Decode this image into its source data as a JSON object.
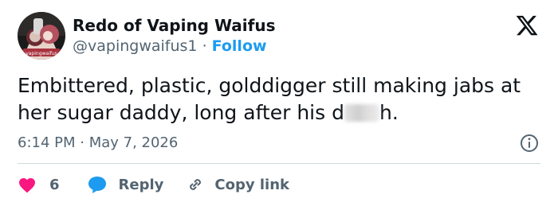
{
  "account": {
    "display_name": "Redo of Vaping Waifus",
    "handle": "@vapingwaifus1",
    "separator": "·",
    "follow_label": "Follow"
  },
  "tweet": {
    "text_before_censor": "Embittered, plastic, golddigger still making jabs at her sugar daddy, long after his d",
    "text_after_censor": "h.",
    "timestamp": "6:14 PM · May 7, 2026"
  },
  "actions": {
    "like_count": "6",
    "reply_label": "Reply",
    "copy_link_label": "Copy link"
  },
  "colors": {
    "link_blue": "#1d9bf0",
    "like_red": "#f91880",
    "muted_gray": "#536471"
  },
  "icons": {
    "logo": "x-logo-icon",
    "info": "info-icon",
    "like": "heart-icon",
    "reply": "speech-bubble-icon",
    "copy": "link-icon"
  }
}
